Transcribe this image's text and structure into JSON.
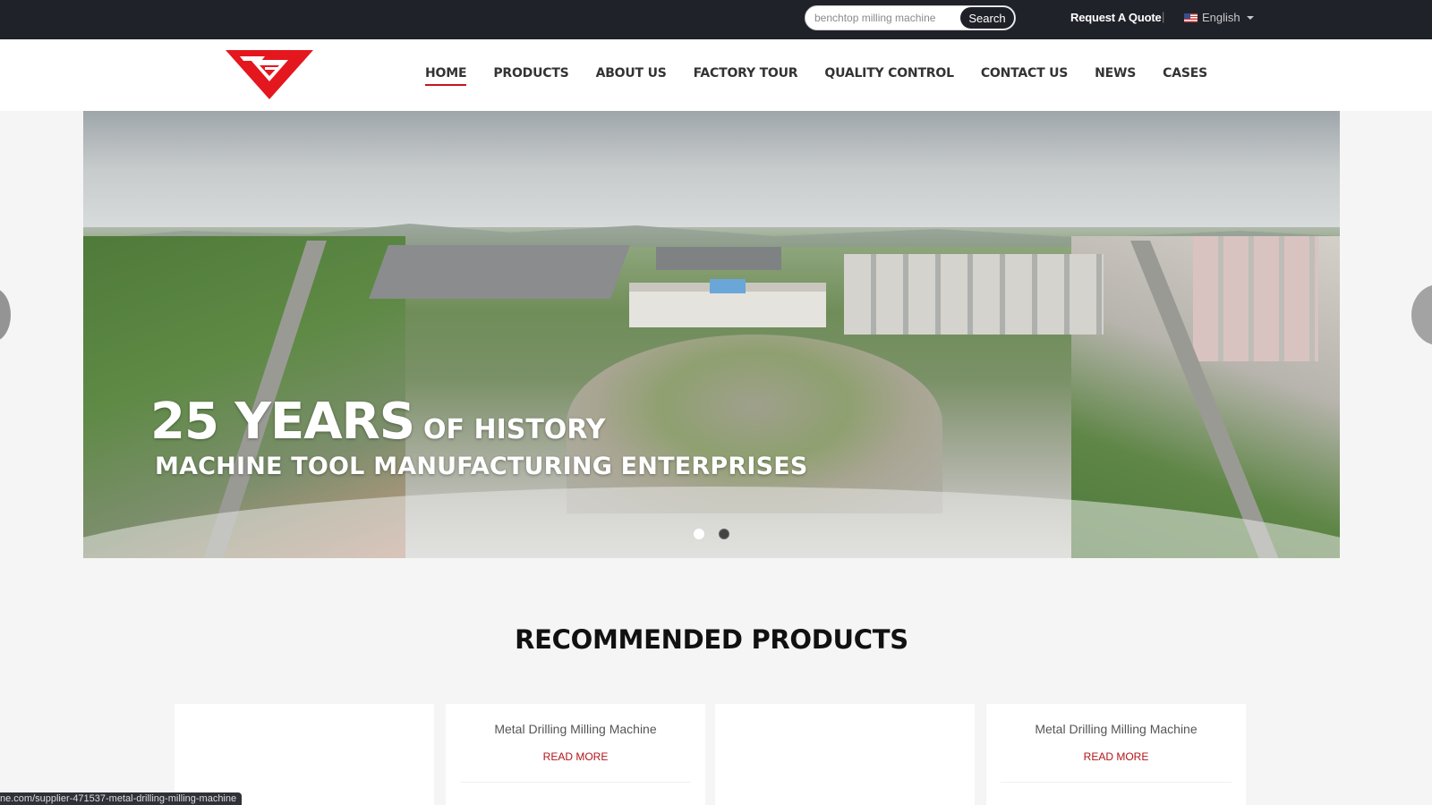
{
  "topbar": {
    "search_placeholder": "benchtop milling machine",
    "search_button": "Search",
    "quote_link": "Request A Quote",
    "separator": "|",
    "language": "English",
    "flag_icon": "us-flag-icon",
    "caret_icon": "chevron-down-icon"
  },
  "header": {
    "logo_icon": "red-shield-logo-icon",
    "nav": [
      {
        "label": "HOME",
        "active": true
      },
      {
        "label": "PRODUCTS"
      },
      {
        "label": "ABOUT US"
      },
      {
        "label": "FACTORY TOUR"
      },
      {
        "label": "QUALITY CONTROL"
      },
      {
        "label": "CONTACT US"
      },
      {
        "label": "NEWS"
      },
      {
        "label": "CASES"
      }
    ]
  },
  "hero": {
    "title_big": "25 YEARS",
    "title_small": "OF HISTORY",
    "subtitle": "MACHINE TOOL MANUFACTURING ENTERPRISES",
    "slides": 2,
    "active_slide": 1
  },
  "recommended": {
    "title": "RECOMMENDED PRODUCTS",
    "cards": [
      {
        "title": "",
        "link": ""
      },
      {
        "title": "Metal Drilling Milling Machine",
        "link": "READ MORE"
      },
      {
        "title": "",
        "link": ""
      },
      {
        "title": "Metal Drilling Milling Machine",
        "link": "READ MORE"
      }
    ]
  },
  "status_url": "ne.com/supplier-471537-metal-drilling-milling-machine",
  "colors": {
    "topbar_bg": "#20222a",
    "accent": "#c4161c",
    "page_bg": "#f5f5f5"
  }
}
